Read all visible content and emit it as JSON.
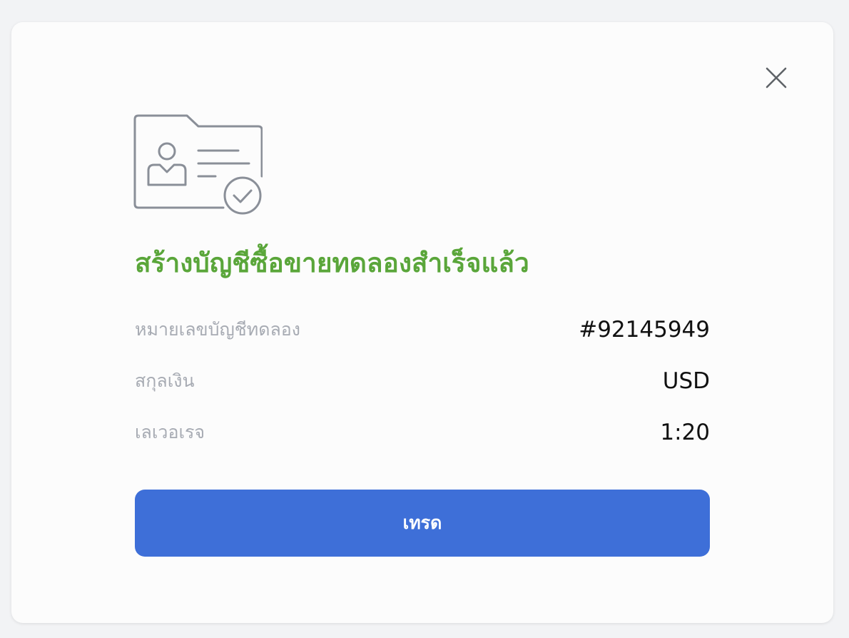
{
  "colors": {
    "success_title": "#5aa63a",
    "primary_button": "#3e6fd8",
    "label_text": "#a7abb3",
    "icon_stroke": "#8a8f98",
    "close_icon": "#5f6368"
  },
  "icons": {
    "close": "close-icon",
    "illustration": "account-folder-check-icon"
  },
  "modal": {
    "title": "สร้างบัญชีซื้อขายทดลองสำเร็จแล้ว",
    "details": [
      {
        "label": "หมายเลขบัญชีทดลอง",
        "value": "#92145949"
      },
      {
        "label": "สกุลเงิน",
        "value": "USD"
      },
      {
        "label": "เลเวอเรจ",
        "value": "1:20"
      }
    ],
    "button_label": "เทรด"
  }
}
